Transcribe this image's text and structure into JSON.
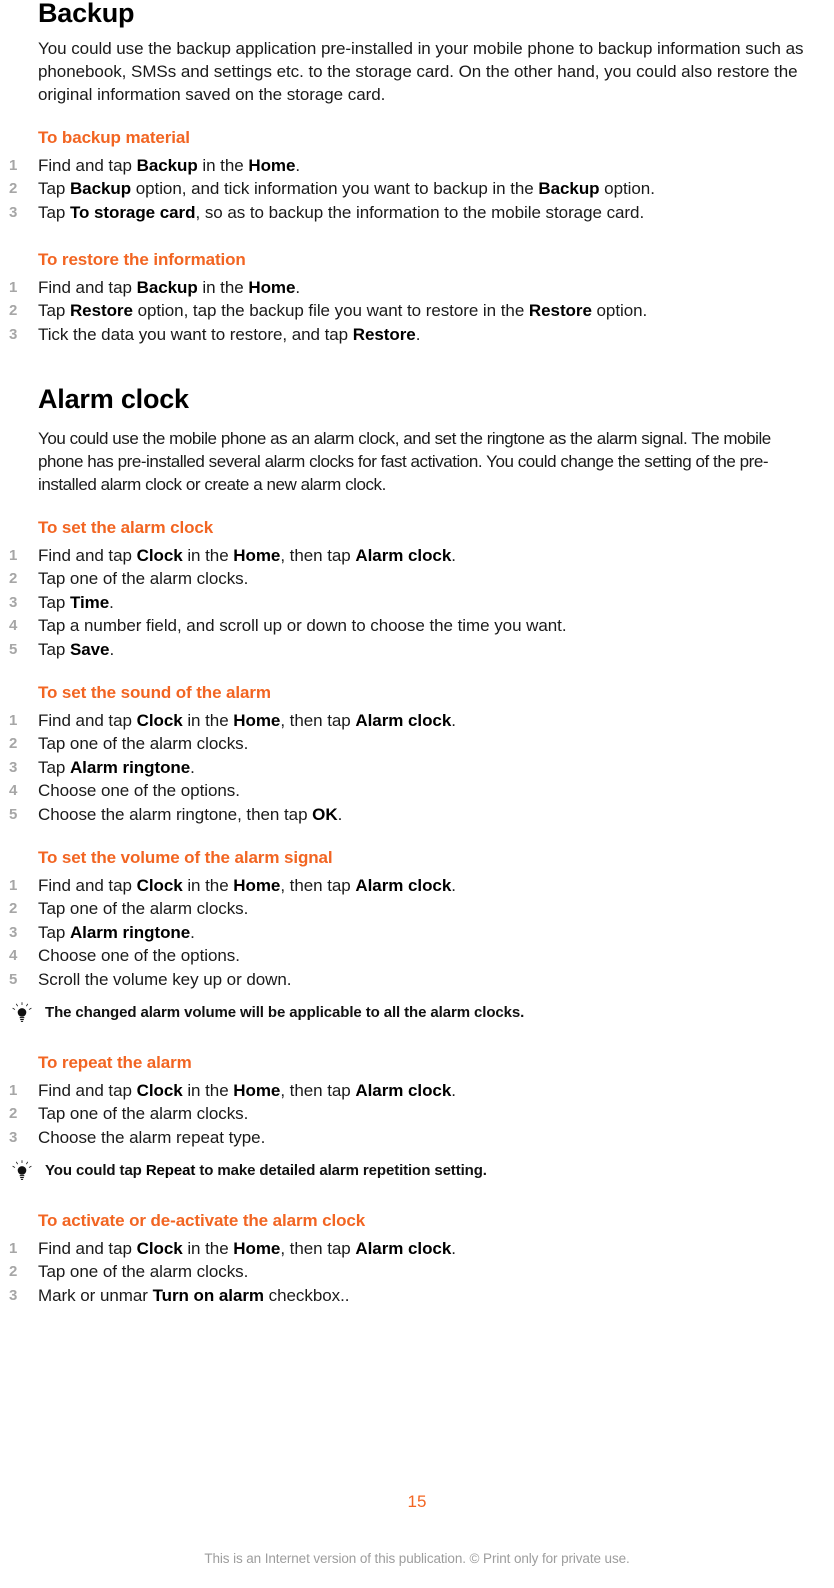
{
  "colors": {
    "accent": "#F26522",
    "step_number": "#a6a6a6",
    "body_text": "#1a1a1a",
    "footer_text": "#9d9d9d",
    "background": "#ffffff"
  },
  "sections": [
    {
      "id": "backup",
      "chapter_title": "Backup",
      "intro": "You could use the backup application pre-installed in your mobile phone to backup information such as phonebook, SMSs and settings etc. to the storage card. On the other hand, you could also restore the original information saved on the storage card.",
      "tasks": [
        {
          "heading": "To backup material",
          "steps": [
            "Find and tap <b>Backup</b> in the <b>Home</b>.",
            "Tap <b>Backup</b> option, and tick information you want to backup in the <b>Backup</b> option.",
            "Tap <b>To storage card</b>, so as to backup the information to the mobile storage card."
          ]
        },
        {
          "heading": "To restore the information",
          "steps": [
            "Find and tap <b>Backup</b> in the <b>Home</b>.",
            "Tap <b>Restore</b> option, tap the backup file you want to restore in the <b>Restore</b> option.",
            "Tick the data you want to restore, and tap <b>Restore</b>."
          ]
        }
      ]
    },
    {
      "id": "alarm-clock",
      "chapter_title": "Alarm clock",
      "intro": "You could use the mobile phone as an alarm clock, and set the ringtone as the alarm signal. The mobile phone has pre-installed several alarm clocks for fast activation. You could change the setting of the pre-installed alarm clock or create a new alarm clock.",
      "tasks": [
        {
          "heading": "To set the alarm clock",
          "steps": [
            "Find and tap <b>Clock</b> in the <b>Home</b>, then tap <b>Alarm clock</b>.",
            "Tap one of the alarm clocks.",
            "Tap <b>Time</b>.",
            "Tap a number field, and scroll up or down to choose the time you want.",
            "Tap <b>Save</b>."
          ]
        },
        {
          "heading": "To set the sound of the alarm",
          "steps": [
            "Find and tap <b>Clock</b> in the <b>Home</b>, then tap <b>Alarm clock</b>.",
            "Tap one of the alarm clocks.",
            "Tap <b>Alarm ringtone</b>.",
            "Choose one of the options.",
            "Choose the alarm ringtone, then tap <b>OK</b>."
          ]
        },
        {
          "heading": "To set the volume of the alarm signal",
          "steps": [
            "Find and tap <b>Clock</b> in the <b>Home</b>, then tap <b>Alarm clock</b>.",
            "Tap one of the alarm clocks.",
            "Tap <b>Alarm ringtone</b>.",
            "Choose one of the options.",
            "Scroll the volume key up or down."
          ],
          "tip": "The changed alarm volume will be applicable to all the alarm clocks."
        },
        {
          "heading": "To repeat the alarm",
          "steps": [
            "Find and tap <b>Clock</b> in the <b>Home</b>, then tap <b>Alarm clock</b>.",
            "Tap one of the alarm clocks.",
            "Choose the alarm repeat type."
          ],
          "tip": "You could tap <b>Repeat</b> to make detailed alarm repetition setting."
        },
        {
          "heading": "To activate or de-activate the alarm clock",
          "steps": [
            "Find and tap <b>Clock</b> in the <b>Home</b>, then tap <b>Alarm clock</b>.",
            "Tap one of the alarm clocks.",
            "Mark or unmar <b>Turn on alarm</b> checkbox.."
          ]
        }
      ]
    }
  ],
  "footer": {
    "page_number": "15",
    "note": "This is an Internet version of this publication. © Print only for private use."
  },
  "icons": {
    "tip": "lightbulb-icon"
  }
}
